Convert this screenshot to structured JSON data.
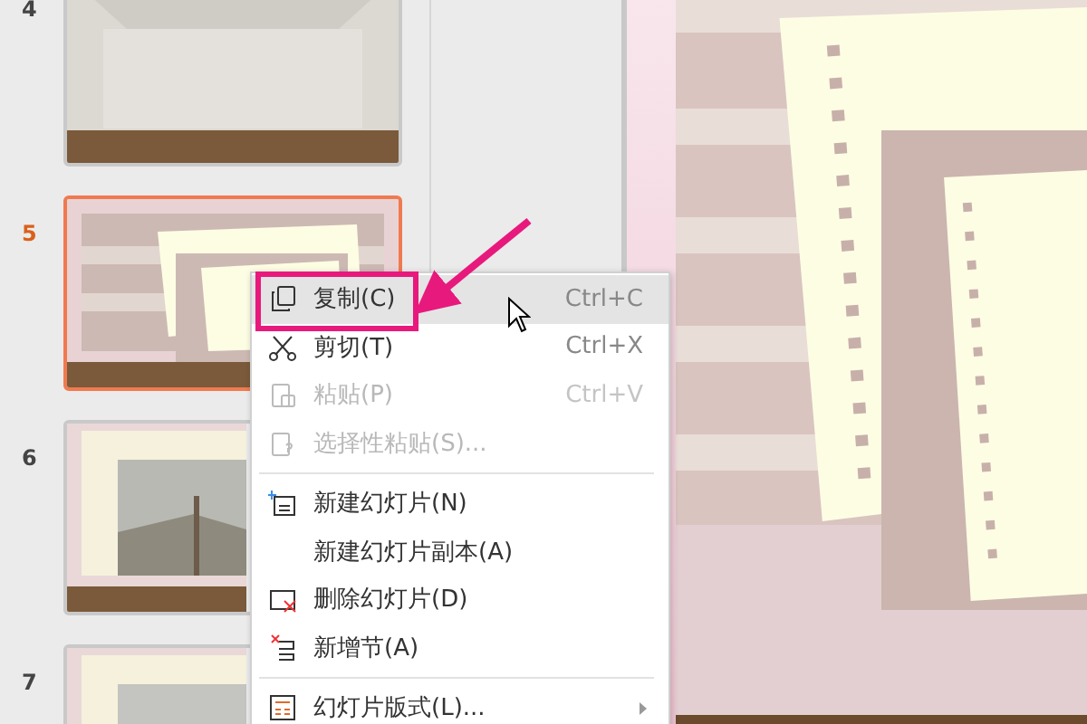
{
  "slides": [
    {
      "number": "4",
      "selected": false
    },
    {
      "number": "5",
      "selected": true
    },
    {
      "number": "6",
      "selected": false
    },
    {
      "number": "7",
      "selected": false
    }
  ],
  "context_menu": {
    "items": [
      {
        "kind": "copy",
        "label": "复制(C)",
        "shortcut": "Ctrl+C",
        "disabled": false,
        "selected": true
      },
      {
        "kind": "cut",
        "label": "剪切(T)",
        "shortcut": "Ctrl+X",
        "disabled": false,
        "selected": false
      },
      {
        "kind": "paste",
        "label": "粘贴(P)",
        "shortcut": "Ctrl+V",
        "disabled": true,
        "selected": false
      },
      {
        "kind": "paste-special",
        "label": "选择性粘贴(S)...",
        "disabled": true,
        "selected": false,
        "separator_after": true
      },
      {
        "kind": "new-slide",
        "label": "新建幻灯片(N)",
        "disabled": false,
        "selected": false
      },
      {
        "kind": "plain",
        "label": "新建幻灯片副本(A)",
        "disabled": false,
        "selected": false
      },
      {
        "kind": "delete-slide",
        "label": "删除幻灯片(D)",
        "disabled": false,
        "selected": false
      },
      {
        "kind": "new-section",
        "label": "新增节(A)",
        "disabled": false,
        "selected": false,
        "separator_after": true
      },
      {
        "kind": "layout",
        "label": "幻灯片版式(L)...",
        "disabled": false,
        "selected": false,
        "submenu": true
      }
    ]
  }
}
